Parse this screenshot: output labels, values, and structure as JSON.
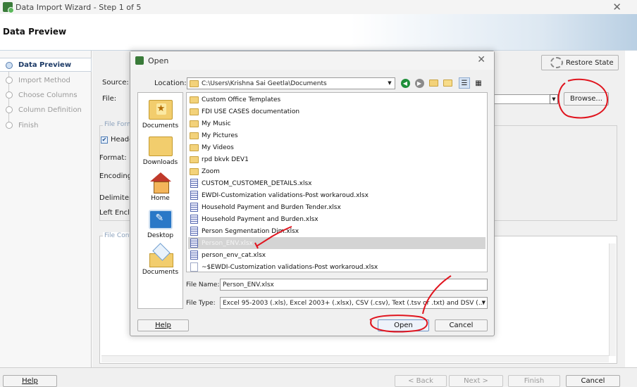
{
  "window": {
    "title": "Data Import Wizard - Step 1 of 5",
    "close_glyph": "✕"
  },
  "page": {
    "heading": "Data Preview"
  },
  "nav": {
    "items": [
      {
        "label": "Data Preview",
        "active": true
      },
      {
        "label": "Import Method",
        "active": false
      },
      {
        "label": "Choose Columns",
        "active": false
      },
      {
        "label": "Column Definition",
        "active": false
      },
      {
        "label": "Finish",
        "active": false
      }
    ]
  },
  "background_form": {
    "restore_label": "Restore State",
    "source_label": "Source:",
    "file_label": "File:",
    "browse_label": "Browse...",
    "file_format_legend": "File Forma",
    "header_label": "Heade",
    "format_label": "Format:",
    "encoding_label": "Encoding:",
    "delimiter_label": "Delimiter:",
    "left_enclosure_label": "Left Enclo",
    "file_contents_legend": "File Cont"
  },
  "dialog": {
    "title": "Open",
    "close_glyph": "✕",
    "location_label": "Location:",
    "location_value": "C:\\Users\\Krishna Sai Geetla\\Documents",
    "places": [
      "Documents",
      "Downloads",
      "Home",
      "Desktop",
      "Documents"
    ],
    "files": [
      {
        "name": "Custom Office Templates",
        "type": "folder"
      },
      {
        "name": "FDI USE CASES documentation",
        "type": "folder"
      },
      {
        "name": "My Music",
        "type": "folder"
      },
      {
        "name": "My Pictures",
        "type": "folder"
      },
      {
        "name": "My Videos",
        "type": "folder"
      },
      {
        "name": "rpd bkvk DEV1",
        "type": "folder"
      },
      {
        "name": "Zoom",
        "type": "folder"
      },
      {
        "name": "CUSTOM_CUSTOMER_DETAILS.xlsx",
        "type": "xlsx"
      },
      {
        "name": "EWDI-Customization validations-Post workaroud.xlsx",
        "type": "xlsx"
      },
      {
        "name": "Household Payment and Burden Tender.xlsx",
        "type": "xlsx"
      },
      {
        "name": "Household Payment and Burden.xlsx",
        "type": "xlsx"
      },
      {
        "name": "Person Segmentation Dim.xlsx",
        "type": "xlsx"
      },
      {
        "name": "Person_ENV.xlsx",
        "type": "xlsx",
        "selected": true
      },
      {
        "name": "person_env_cat.xlsx",
        "type": "xlsx"
      },
      {
        "name": "~$EWDI-Customization validations-Post workaroud.xlsx",
        "type": "blank"
      }
    ],
    "file_name_label": "File Name:",
    "file_name_value": "Person_ENV.xlsx",
    "file_type_label": "File Type:",
    "file_type_value": "Excel 95-2003 (.xls), Excel 2003+ (.xlsx), CSV (.csv), Text (.tsv or .txt) and DSV (...",
    "help_label": "Help",
    "open_label": "Open",
    "cancel_label": "Cancel"
  },
  "footer": {
    "help_label": "Help",
    "back_label": "< Back",
    "next_label": "Next >",
    "finish_label": "Finish",
    "cancel_label": "Cancel"
  },
  "colors": {
    "accent": "#1c3a66",
    "annotation": "#e0141e"
  }
}
